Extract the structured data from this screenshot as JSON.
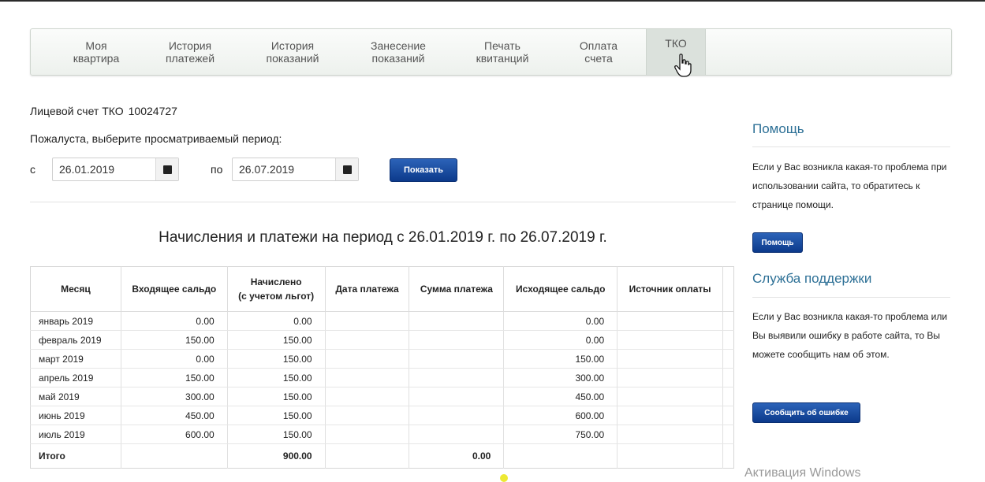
{
  "nav": {
    "items": [
      {
        "label": "Моя\nквартира"
      },
      {
        "label": "История\nплатежей"
      },
      {
        "label": "История\nпоказаний"
      },
      {
        "label": "Занесение\nпоказаний"
      },
      {
        "label": "Печать\nквитанций"
      },
      {
        "label": "Оплата\nсчета"
      },
      {
        "label": "ТКО"
      }
    ],
    "active_index": 6
  },
  "account": {
    "label": "Лицевой счет ТКО",
    "number": "10024727"
  },
  "period": {
    "prompt": "Пожалуста, выберите просматриваемый период:",
    "from_label": "с",
    "from_value": "26.01.2019",
    "to_label": "по",
    "to_value": "26.07.2019",
    "show_button": "Показать"
  },
  "report": {
    "title": "Начисления и платежи на период с 26.01.2019 г. по 26.07.2019 г.",
    "columns": [
      "Месяц",
      "Входящее сальдо",
      "Начислено\n(с учетом льгот)",
      "Дата платежа",
      "Сумма платежа",
      "Исходящее сальдо",
      "Источник оплаты"
    ],
    "rows": [
      [
        "январь 2019",
        "0.00",
        "0.00",
        "",
        "",
        "0.00",
        ""
      ],
      [
        "февраль 2019",
        "150.00",
        "150.00",
        "",
        "",
        "0.00",
        ""
      ],
      [
        "март 2019",
        "0.00",
        "150.00",
        "",
        "",
        "150.00",
        ""
      ],
      [
        "апрель 2019",
        "150.00",
        "150.00",
        "",
        "",
        "300.00",
        ""
      ],
      [
        "май 2019",
        "300.00",
        "150.00",
        "",
        "",
        "450.00",
        ""
      ],
      [
        "июнь 2019",
        "450.00",
        "150.00",
        "",
        "",
        "600.00",
        ""
      ],
      [
        "июль 2019",
        "600.00",
        "150.00",
        "",
        "",
        "750.00",
        ""
      ]
    ],
    "total": [
      "Итого",
      "",
      "900.00",
      "",
      "0.00",
      "",
      ""
    ]
  },
  "sidebar": {
    "help": {
      "title": "Помощь",
      "text": "Если у Вас возникла какая-то проблема при использовании сайта, то обратитесь к странице помощи.",
      "button": "Помощь"
    },
    "support": {
      "title": "Служба поддержки",
      "text": "Если у Вас возникла какая-то проблема или Вы выявили ошибку в работе сайта, то Вы можете сообщить нам об этом.",
      "button": "Сообщить об ошибке"
    }
  },
  "watermark": "Активация Windows"
}
